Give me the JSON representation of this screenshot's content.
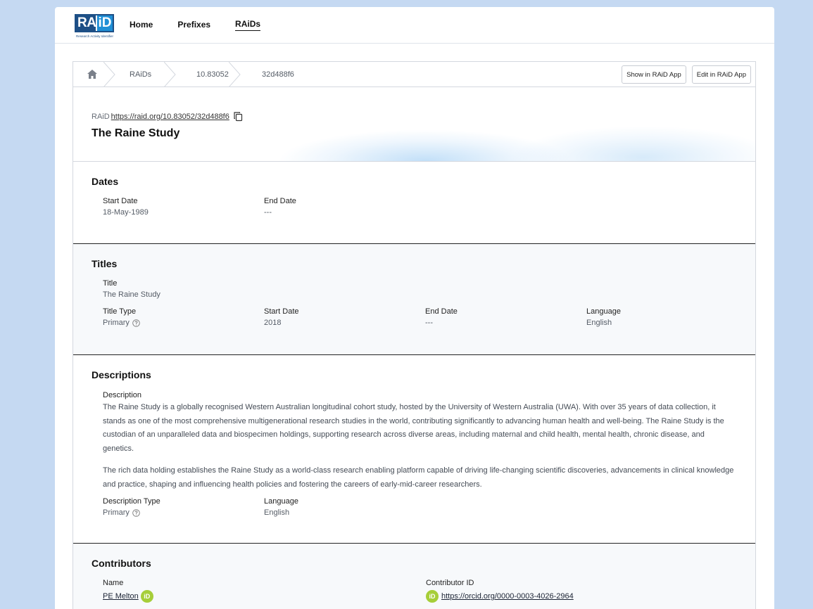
{
  "logo": {
    "text_ra": "RA",
    "text_id": "iD",
    "tagline": "Research Activity Identifier"
  },
  "nav": {
    "home": "Home",
    "prefixes": "Prefixes",
    "raids": "RAiDs"
  },
  "breadcrumb": {
    "items": [
      "RAiDs",
      "10.83052",
      "32d488f6"
    ]
  },
  "actions": {
    "show": "Show in RAiD App",
    "edit": "Edit in RAiD App"
  },
  "header": {
    "raid_label": "RAiD",
    "raid_url": "https://raid.org/10.83052/32d488f6",
    "title": "The Raine Study"
  },
  "dates": {
    "heading": "Dates",
    "start_label": "Start Date",
    "start_value": "18-May-1989",
    "end_label": "End Date",
    "end_value": "---"
  },
  "titles": {
    "heading": "Titles",
    "title_label": "Title",
    "title_value": "The Raine Study",
    "type_label": "Title Type",
    "type_value": "Primary",
    "start_label": "Start Date",
    "start_value": "2018",
    "end_label": "End Date",
    "end_value": "---",
    "lang_label": "Language",
    "lang_value": "English"
  },
  "descriptions": {
    "heading": "Descriptions",
    "desc_label": "Description",
    "para1": "The Raine Study is a globally recognised Western Australian longitudinal cohort study, hosted by the University of Western Australia (UWA). With over 35 years of data collection, it stands as one of the most comprehensive multigenerational research studies in the world, contributing significantly to advancing human health and well-being. The Raine Study is the custodian of an unparalleled data and biospecimen holdings, supporting research across diverse areas, including maternal and child health, mental health, chronic disease, and genetics.",
    "para2": "The rich data holding establishes the Raine Study as a world-class research enabling platform capable of driving life-changing scientific discoveries, advancements in clinical knowledge and practice, shaping and influencing health policies and fostering the careers of early-mid-career researchers.",
    "type_label": "Description Type",
    "type_value": "Primary",
    "lang_label": "Language",
    "lang_value": "English"
  },
  "contributors": {
    "heading": "Contributors",
    "name_label": "Name",
    "name_value": "PE Melton",
    "id_label": "Contributor ID",
    "id_value": "https://orcid.org/0000-0003-4026-2964",
    "orcid_badge": "iD"
  },
  "colors": {
    "background": "#c5d9f2",
    "logo_dark": "#1d4f86",
    "logo_light": "#1f8fd6",
    "orcid": "#a6ce39"
  }
}
